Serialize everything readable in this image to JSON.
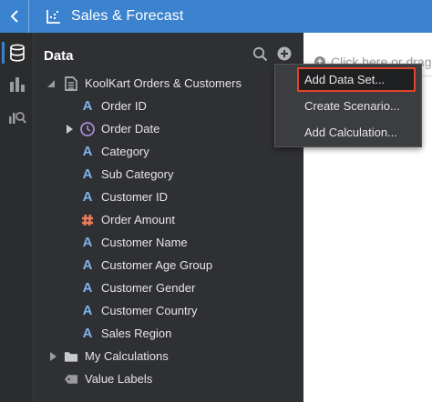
{
  "header": {
    "title": "Sales & Forecast"
  },
  "panel": {
    "title": "Data",
    "dataset": "KoolKart Orders & Customers",
    "columns": [
      "Order ID",
      "Order Date",
      "Category",
      "Sub Category",
      "Customer ID",
      "Order Amount",
      "Customer Name",
      "Customer Age Group",
      "Customer Gender",
      "Customer Country",
      "Sales Region"
    ],
    "my_calculations": "My Calculations",
    "value_labels": "Value Labels"
  },
  "menu": {
    "items": [
      "Add Data Set...",
      "Create Scenario...",
      "Add Calculation..."
    ]
  },
  "canvas": {
    "hint": "Click here or drag"
  },
  "colors": {
    "accent": "#3b82cf",
    "highlight_outline": "#e0452b",
    "attribute_icon": "#7fb3ea",
    "measure_icon": "#e87a5d"
  }
}
